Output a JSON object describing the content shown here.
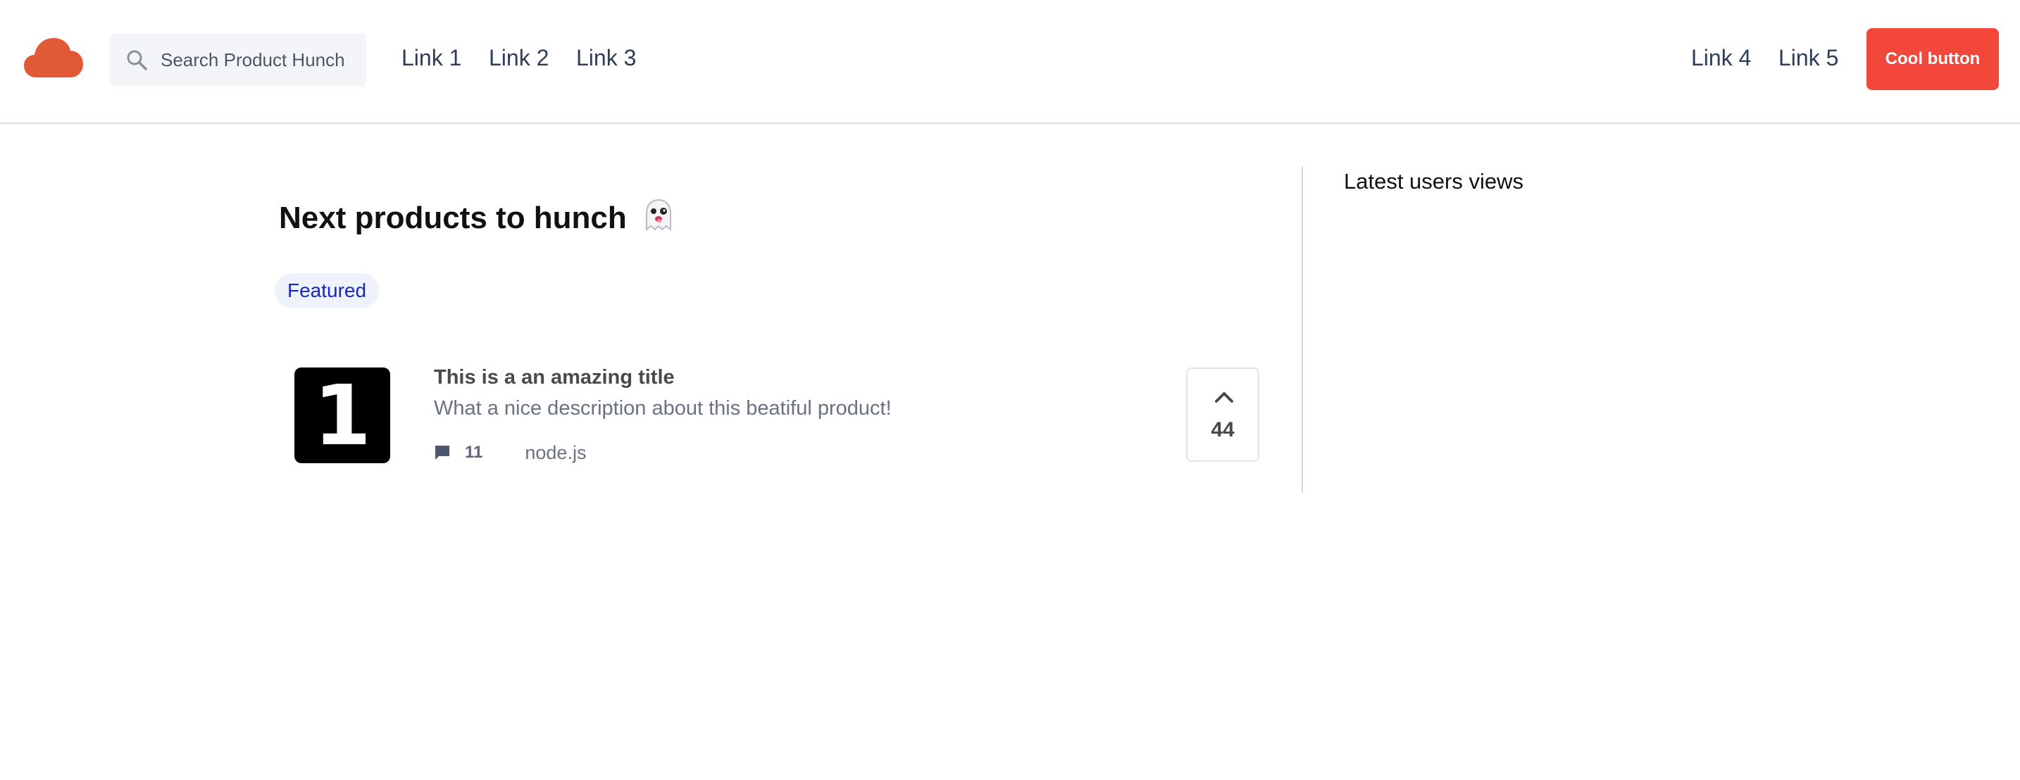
{
  "header": {
    "logo_icon": "cloud-icon",
    "logo_color": "#e05a36",
    "search": {
      "placeholder": "Search Product Hunch",
      "value": "",
      "icon": "search-icon"
    },
    "nav_left": [
      "Link 1",
      "Link 2",
      "Link 3"
    ],
    "nav_right": [
      "Link 4",
      "Link 5"
    ],
    "cta_label": "Cool button",
    "cta_color": "#f4473c"
  },
  "main": {
    "title": "Next products to hunch",
    "title_icon": "ghost-icon",
    "filter_label": "Featured",
    "products": [
      {
        "rank": "1",
        "title": "This is a an amazing title",
        "description": "What a nice description about this beatiful product!",
        "comments": "11",
        "comment_icon": "comment-icon",
        "tag": "node.js",
        "votes": "44",
        "vote_icon": "chevron-up-icon"
      }
    ]
  },
  "sidebar": {
    "title": "Latest users views"
  }
}
